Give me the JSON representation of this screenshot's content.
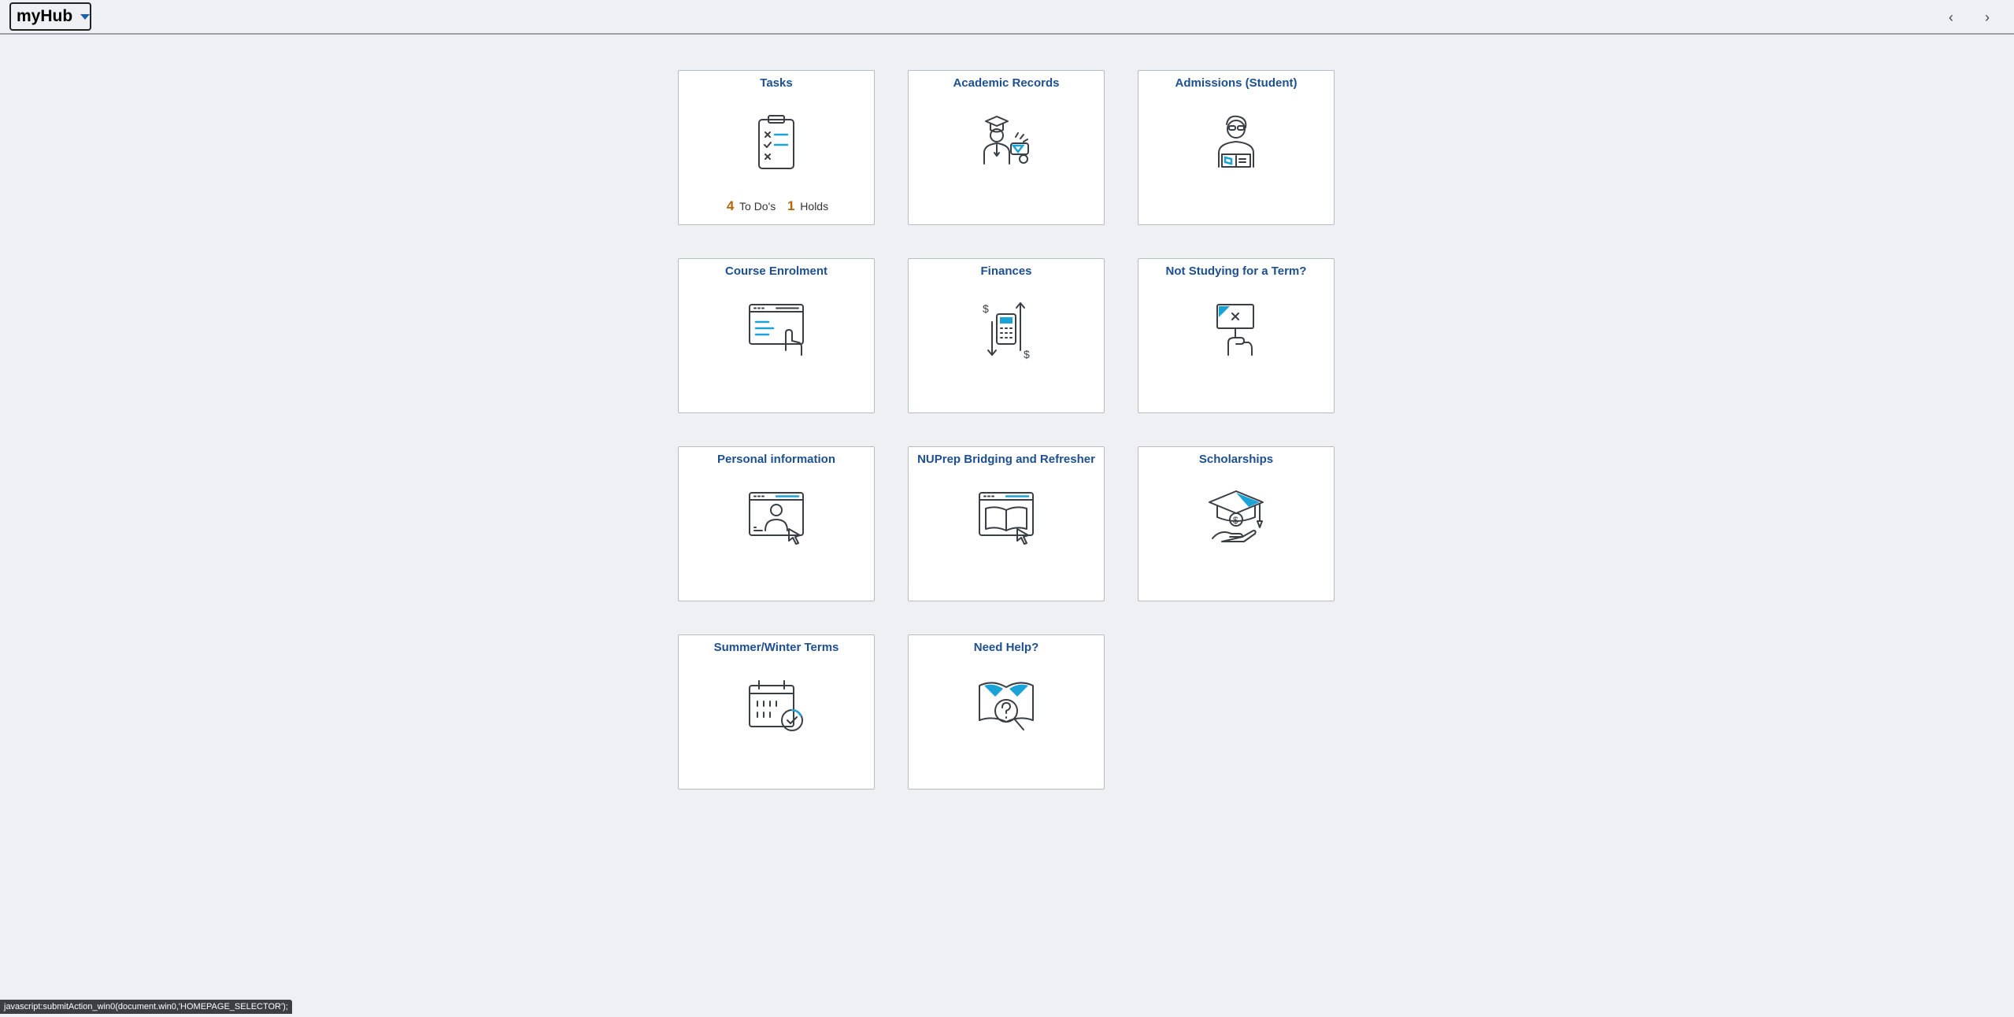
{
  "header": {
    "hub_title": "myHub"
  },
  "tiles": [
    {
      "title": "Tasks",
      "icon": "clipboard-checklist-icon"
    },
    {
      "title": "Academic Records",
      "icon": "graduate-diploma-icon"
    },
    {
      "title": "Admissions (Student)",
      "icon": "student-reading-icon"
    },
    {
      "title": "Course Enrolment",
      "icon": "browser-click-icon"
    },
    {
      "title": "Finances",
      "icon": "calculator-dollar-exchange-icon"
    },
    {
      "title": "Not Studying for a Term?",
      "icon": "hand-sign-cancel-icon"
    },
    {
      "title": "Personal information",
      "icon": "browser-profile-icon"
    },
    {
      "title": "NUPrep Bridging and Refresher",
      "icon": "browser-book-icon"
    },
    {
      "title": "Scholarships",
      "icon": "grad-cap-money-hand-icon"
    },
    {
      "title": "Summer/Winter Terms",
      "icon": "calendar-check-icon"
    },
    {
      "title": "Need Help?",
      "icon": "book-question-magnifier-icon"
    }
  ],
  "tasks": {
    "todos_count": "4",
    "todos_label": "To Do's",
    "holds_count": "1",
    "holds_label": "Holds"
  },
  "status_bar": "javascript:submitAction_win0(document.win0,'HOMEPAGE_SELECTOR');",
  "colors": {
    "accent": "#1d4f91",
    "icon_highlight": "#1ba3d8",
    "count": "#b3670a"
  }
}
